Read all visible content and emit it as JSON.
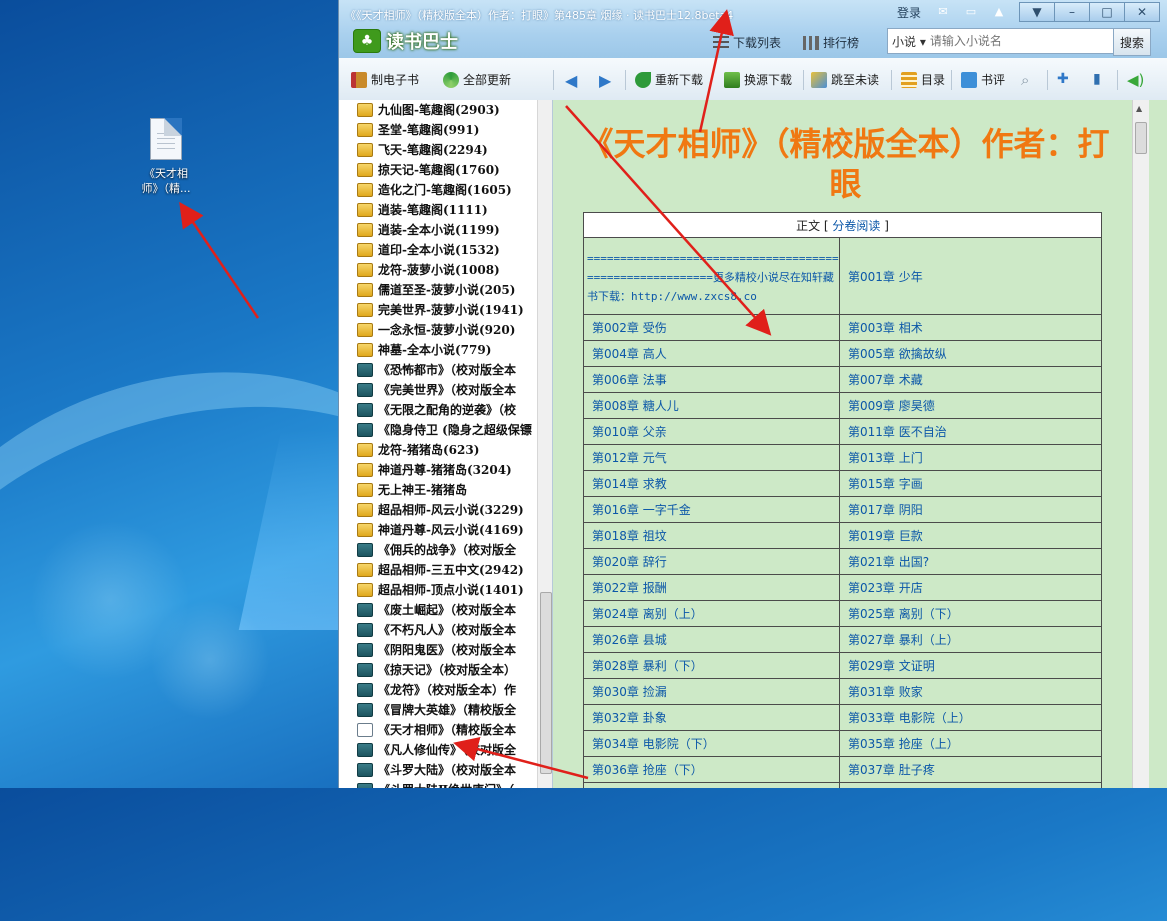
{
  "desktop": {
    "file_label_line1": "《天才相",
    "file_label_line2": "师》（精..."
  },
  "window": {
    "title": "《《天才相师》（精校版全本）作者：打眼》第485章 烟缘 · 读书巴士12.8beta4",
    "app_name": "读书巴士",
    "login": "登录",
    "download_list": "下载列表",
    "rankings": "排行榜",
    "search_category": "小说",
    "search_placeholder": "请输入小说名",
    "search_button": "搜索"
  },
  "toolbar": {
    "make_ebook": "制电子书",
    "update_all": "全部更新",
    "redownload": "重新下载",
    "switch_source": "换源下载",
    "jump_unread": "跳至未读",
    "toc": "目录",
    "review": "书评"
  },
  "book_list": [
    {
      "label": "九仙图-笔趣阁(2903)",
      "type": "y"
    },
    {
      "label": "圣堂-笔趣阁(991)",
      "type": "y"
    },
    {
      "label": "飞天-笔趣阁(2294)",
      "type": "y"
    },
    {
      "label": "掠天记-笔趣阁(1760)",
      "type": "y"
    },
    {
      "label": "造化之门-笔趣阁(1605)",
      "type": "y"
    },
    {
      "label": "逍装-笔趣阁(1111)",
      "type": "y"
    },
    {
      "label": "逍装-全本小说(1199)",
      "type": "y"
    },
    {
      "label": "道印-全本小说(1532)",
      "type": "y"
    },
    {
      "label": "龙符-菠萝小说(1008)",
      "type": "y"
    },
    {
      "label": "儒道至圣-菠萝小说(205)",
      "type": "y"
    },
    {
      "label": "完美世界-菠萝小说(1941)",
      "type": "y"
    },
    {
      "label": "一念永恒-菠萝小说(920)",
      "type": "y"
    },
    {
      "label": "神墓-全本小说(779)",
      "type": "y"
    },
    {
      "label": "《恐怖都市》（校对版全本",
      "type": "g"
    },
    {
      "label": "《完美世界》（校对版全本",
      "type": "g"
    },
    {
      "label": "《无限之配角的逆袭》（校",
      "type": "g"
    },
    {
      "label": "《隐身侍卫 (隐身之超级保镖",
      "type": "g"
    },
    {
      "label": "龙符-猪猪岛(623)",
      "type": "y"
    },
    {
      "label": "神道丹尊-猪猪岛(3204)",
      "type": "y"
    },
    {
      "label": "无上神王-猪猪岛",
      "type": "y"
    },
    {
      "label": "超品相师-风云小说(3229)",
      "type": "y"
    },
    {
      "label": "神道丹尊-风云小说(4169)",
      "type": "y"
    },
    {
      "label": "《佣兵的战争》（校对版全",
      "type": "g"
    },
    {
      "label": "超品相师-三五中文(2942)",
      "type": "y"
    },
    {
      "label": "超品相师-顶点小说(1401)",
      "type": "y"
    },
    {
      "label": "《废土崛起》（校对版全本",
      "type": "g"
    },
    {
      "label": "《不朽凡人》（校对版全本",
      "type": "g"
    },
    {
      "label": "《阴阳鬼医》（校对版全本",
      "type": "g"
    },
    {
      "label": "《掠天记》（校对版全本）",
      "type": "g"
    },
    {
      "label": "《龙符》（校对版全本）作",
      "type": "g"
    },
    {
      "label": "《冒牌大英雄》（精校版全",
      "type": "g"
    },
    {
      "label": "《天才相师》（精校版全本",
      "type": "o"
    },
    {
      "label": "《凡人修仙传》（校对版全",
      "type": "g"
    },
    {
      "label": "《斗罗大陆》（校对版全本",
      "type": "g"
    },
    {
      "label": "《斗罗大陆Ⅱ绝世唐门》（",
      "type": "g"
    }
  ],
  "content": {
    "book_title": "《天才相师》（精校版全本）作者：打眼",
    "toc_header": "正文",
    "toc_header_link": "分卷阅读",
    "first_cell": "=========================================================更多精校小说尽在知轩藏书下载：http://www.zxcs8.co",
    "chapters": [
      "第001章 少年",
      "第002章 受伤",
      "第003章 相术",
      "第004章 高人",
      "第005章 欲擒故纵",
      "第006章 法事",
      "第007章 术藏",
      "第008章 糖人儿",
      "第009章 廖昊德",
      "第010章 父亲",
      "第011章 医不自治",
      "第012章 元气",
      "第013章 上门",
      "第014章 求教",
      "第015章 字画",
      "第016章 一字千金",
      "第017章 阴阳",
      "第018章 祖坟",
      "第019章 巨款",
      "第020章 辞行",
      "第021章 出国?",
      "第022章 报酬",
      "第023章 开店",
      "第024章 离别（上）",
      "第025章 离别（下）",
      "第026章 县城",
      "第027章 暴利（上）",
      "第028章 暴利（下）",
      "第029章 文证明",
      "第030章 捡漏",
      "第031章 败家",
      "第032章 卦象",
      "第033章 电影院（上）",
      "第034章 电影院（下）",
      "第035章 抢座（上）",
      "第036章 抢座（下）",
      "第037章 肚子疼",
      "第038章 钱途",
      "第039章 出事了"
    ]
  },
  "colors": {
    "title_orange": "#f07812",
    "link_blue": "#0b57a8",
    "content_bg": "#cde9c7",
    "arrow_red": "#e0201a"
  }
}
